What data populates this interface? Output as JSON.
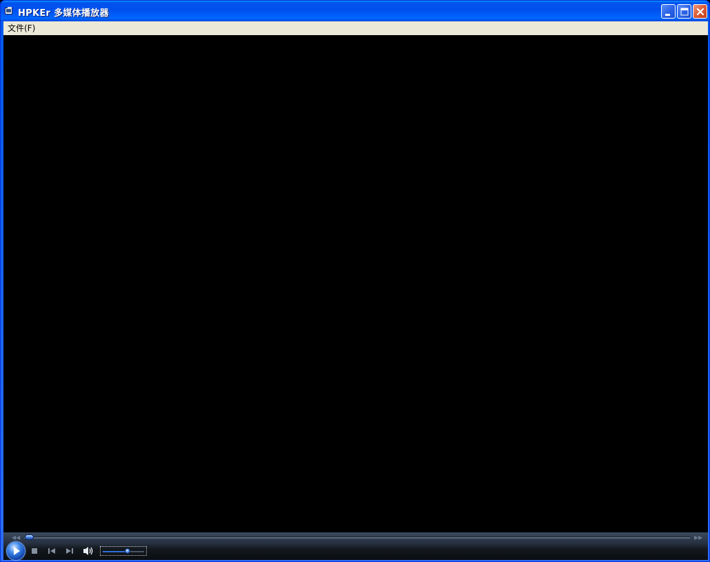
{
  "window": {
    "title": "HPKEr 多媒体播放器"
  },
  "menu": {
    "items": [
      {
        "label": "文件(F)"
      }
    ]
  },
  "player": {
    "seek_position": 0.0,
    "volume_level": 0.6,
    "controls": {
      "play_icon": "play-icon",
      "stop_icon": "stop-icon",
      "previous_icon": "previous-track-icon",
      "next_icon": "next-track-icon",
      "mute_icon": "speaker-icon"
    }
  },
  "colors": {
    "titlebar": "#0054e3",
    "menubar": "#ece9d8",
    "video_background": "#000000",
    "accent": "#2f6ed8",
    "close_button": "#dd5c36"
  }
}
